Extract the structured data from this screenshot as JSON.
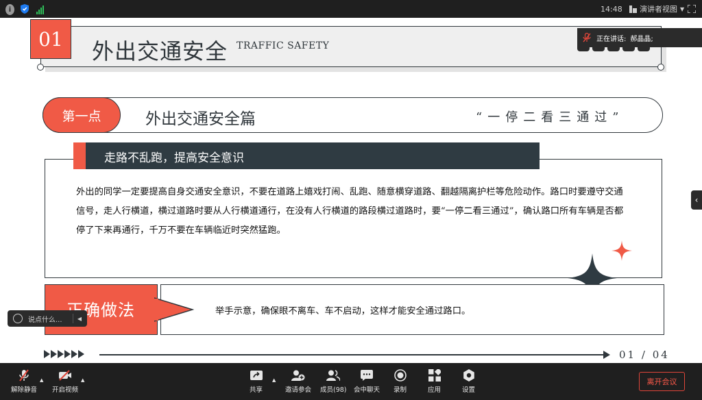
{
  "status_bar": {
    "clock": "14:48",
    "presenter_view_label": "演讲者视图",
    "icons": [
      "info-icon",
      "shield-icon",
      "signal-icon",
      "presenter-view-icon",
      "fullscreen-icon"
    ]
  },
  "speaking": {
    "label": "正在讲话:",
    "name": "郝晶晶;"
  },
  "slide": {
    "number": "01",
    "title": "外出交通安全",
    "title_en": "TRAFFIC SAFETY",
    "point_label": "第一点",
    "section_title": "外出交通安全篇",
    "quote": "“一停二看三通过”",
    "subheading": "走路不乱跑，提高安全意识",
    "paragraph": "外出的同学一定要提高自身交通安全意识，不要在道路上嬉戏打闹、乱跑、随意横穿道路、翻越隔离护栏等危险动作。路口时要遵守交通信号，走人行横道，横过道路时要从人行横道通行，在没有人行横道的路段横过道路时，要“一停二看三通过”，确认路口所有车辆是否都停了下来再通行，千万不要在车辆临近时突然猛跑。",
    "correct_label": "正确做法",
    "correct_text": "举手示意，确保眼不离车、车不启动，这样才能安全通过路口。",
    "page_current": "01",
    "page_sep": "/",
    "page_total": "04",
    "colors": {
      "accent": "#f05a46",
      "dark": "#30373c",
      "banner": "#2f3b42"
    }
  },
  "chat": {
    "placeholder": "说点什么..."
  },
  "toolbar": {
    "unmute": "解除静音",
    "start_video": "开启视频",
    "share": "共享",
    "invite": "邀请参会",
    "members": "成员(98)",
    "chat": "会中聊天",
    "record": "录制",
    "apps": "应用",
    "settings": "设置",
    "leave": "离开会议"
  }
}
